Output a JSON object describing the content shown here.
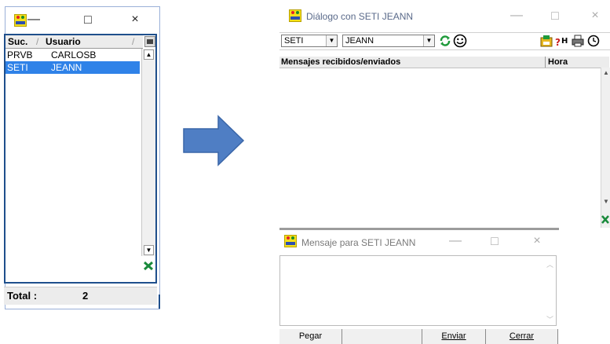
{
  "left_window": {
    "columns": [
      "Suc.",
      "Usuario"
    ],
    "rows": [
      {
        "suc": "PRVB",
        "usuario": "CARLOSB"
      },
      {
        "suc": "SETI",
        "usuario": "JEANN"
      }
    ],
    "total_label": "Total :",
    "total_value": "2",
    "controls": {
      "minimize": "—",
      "maximize": "□",
      "close": "×"
    }
  },
  "dialog": {
    "title": "Diálogo con SETI JEANN",
    "controls": {
      "minimize": "—",
      "maximize": "□",
      "close": "×"
    },
    "branch_combo": "SETI",
    "user_combo": "JEANN",
    "messages_header": "Mensajes recibidos/enviados",
    "time_header": "Hora"
  },
  "compose": {
    "title": "Mensaje para SETI JEANN",
    "controls": {
      "minimize": "—",
      "maximize": "□",
      "close": "×"
    },
    "buttons": {
      "paste": "Pegar",
      "send": "Enviar",
      "close": "Cerrar"
    }
  },
  "icons": {
    "app": "seti-app-icon",
    "refresh": "refresh-icon",
    "smiley": "smiley-icon",
    "print": "printer-icon"
  },
  "colors": {
    "selection": "#2f82e8",
    "arrow": "#4f7ec4",
    "list_border": "#1f4f8c"
  }
}
